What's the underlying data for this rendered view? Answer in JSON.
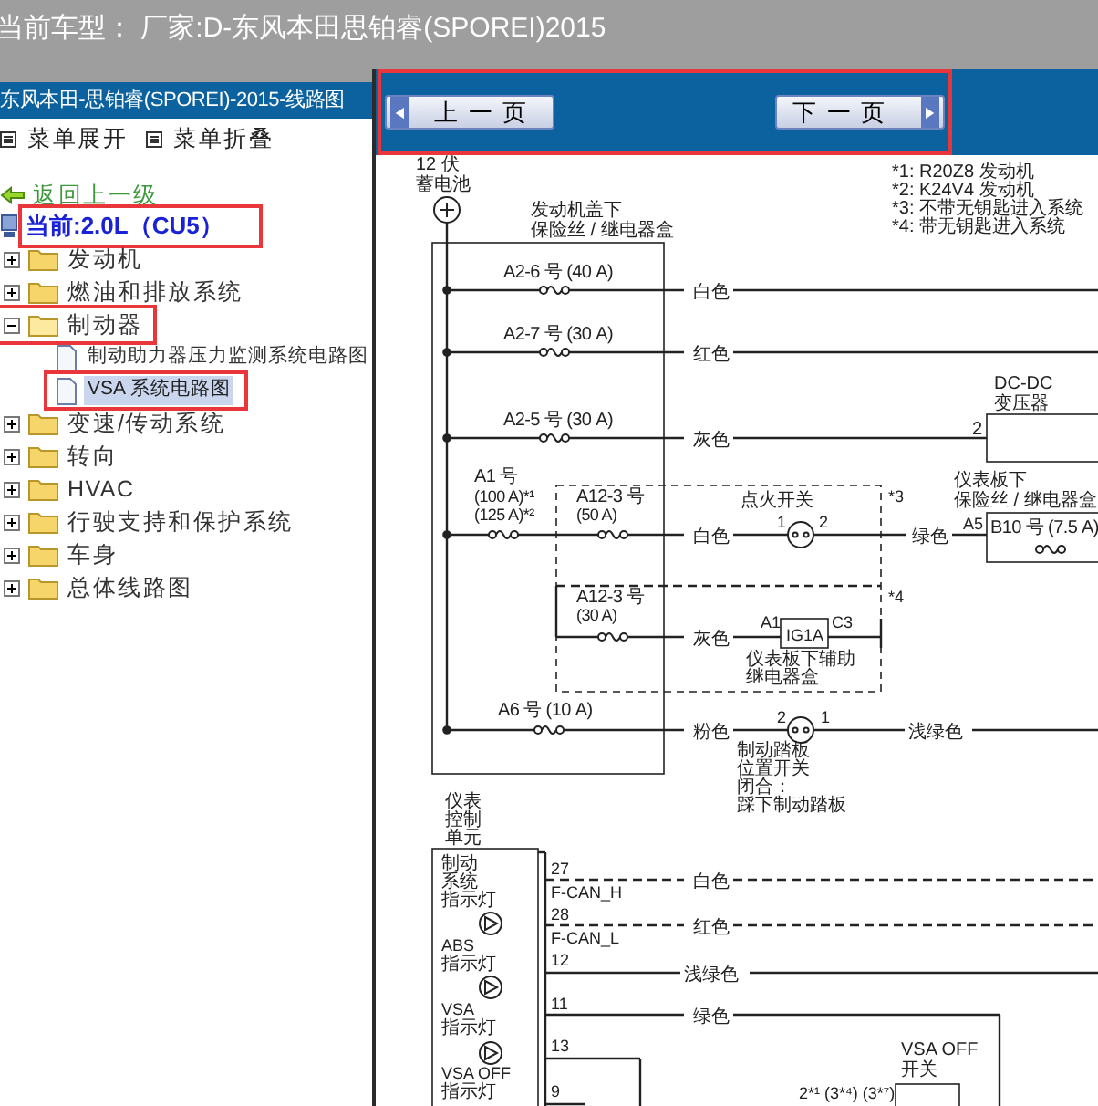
{
  "header": {
    "title": "当前车型： 厂家:D-东风本田思铂睿(SPOREI)2015"
  },
  "sidebar": {
    "title": "东风本田-思铂睿(SPOREI)-2015-线路图",
    "menu": [
      {
        "label": "菜单展开"
      },
      {
        "label": "菜单折叠"
      }
    ],
    "back_link": "返回上一级",
    "current": {
      "label": "当前:2.0L（CU5）",
      "highlighted": true
    },
    "tree": [
      {
        "label": "发动机",
        "expanded": false,
        "highlighted": false
      },
      {
        "label": "燃油和排放系统",
        "expanded": false,
        "highlighted": false
      },
      {
        "label": "制动器",
        "expanded": true,
        "highlighted": true,
        "children": [
          {
            "label": "制动助力器压力监测系统电路图",
            "selected": false,
            "highlighted": false
          },
          {
            "label": "VSA 系统电路图",
            "selected": true,
            "highlighted": true
          }
        ]
      },
      {
        "label": "变速/传动系统",
        "expanded": false,
        "highlighted": false
      },
      {
        "label": "转向",
        "expanded": false,
        "highlighted": false
      },
      {
        "label": "HVAC",
        "expanded": false,
        "highlighted": false
      },
      {
        "label": "行驶支持和保护系统",
        "expanded": false,
        "highlighted": false
      },
      {
        "label": "车身",
        "expanded": false,
        "highlighted": false
      },
      {
        "label": "总体线路图",
        "expanded": false,
        "highlighted": false
      }
    ]
  },
  "nav": {
    "highlighted": true,
    "buttons": [
      {
        "label": "上一页",
        "kind": "prev"
      },
      {
        "label": "下一页",
        "kind": "next"
      }
    ]
  },
  "diagram": {
    "labels": [
      "12 伏",
      "蓄电池",
      "发动机盖下",
      "保险丝 / 继电器盒",
      "*1: R20Z8 发动机",
      "*2: K24V4 发动机",
      "*3: 不带无钥匙进入系统",
      "*4: 带无钥匙进入系统",
      "A2-6 号 (40 A)",
      "白色",
      "A2-7 号 (30 A)",
      "红色",
      "A2-5 号 (30 A)",
      "灰色",
      "DC-DC",
      "变压器",
      "2",
      "A1 号",
      "仪表板下",
      "(100 A)*¹",
      "A12-3 号",
      "点火开关",
      "*3",
      "保险丝 / 继电器盒",
      "(125 A)*²",
      "(50 A)",
      "1",
      "2",
      "A5",
      "B10 号 (7.5 A)",
      "白色",
      "绿色",
      "A12-3 号",
      "*4",
      "(30 A)",
      "灰色",
      "A1",
      "IG1A",
      "C3",
      "仪表板下辅助",
      "继电器盒",
      "A6 号 (10 A)",
      "粉色",
      "2",
      "1",
      "浅绿色",
      "制动踏板",
      "位置开关",
      "闭合：",
      "踩下制动踏板",
      "仪表",
      "控制",
      "单元",
      "制动",
      "系统",
      "指示灯",
      "ABS",
      "指示灯",
      "VSA",
      "指示灯",
      "VSA OFF",
      "指示灯",
      "27",
      "F-CAN_H",
      "白色",
      "28",
      "F-CAN_L",
      "红色",
      "12",
      "浅绿色",
      "11",
      "绿色",
      "13",
      "VSA OFF",
      "开关",
      "9",
      "2*¹ (3*⁴) (3*⁷)"
    ]
  }
}
